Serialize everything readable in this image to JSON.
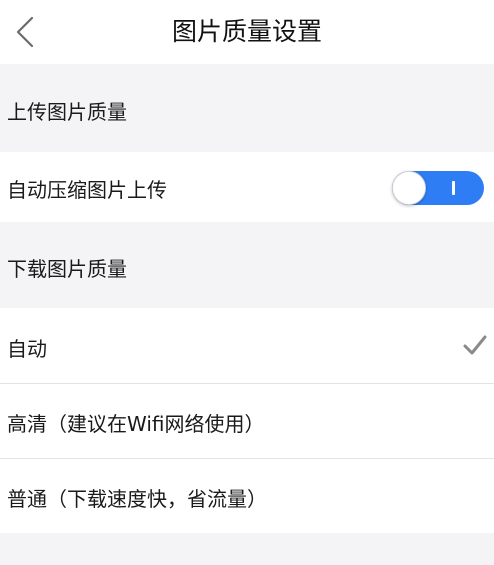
{
  "header": {
    "back_icon": "chevron-left-icon",
    "title": "图片质量设置"
  },
  "upload": {
    "section_title": "上传图片质量",
    "auto_compress_label": "自动压缩图片上传",
    "auto_compress_enabled": true
  },
  "download": {
    "section_title": "下载图片质量",
    "options": [
      {
        "label": "自动",
        "selected": true
      },
      {
        "label": "高清（建议在Wifi网络使用）",
        "selected": false
      },
      {
        "label": "普通（下载速度快，省流量）",
        "selected": false
      }
    ]
  },
  "colors": {
    "background": "#f4f4f6",
    "row_background": "#ffffff",
    "toggle_on": "#2f7df5",
    "check": "#8a8a8a"
  },
  "icons": {
    "toggle": "toggle-switch",
    "selected_mark": "check-icon"
  }
}
